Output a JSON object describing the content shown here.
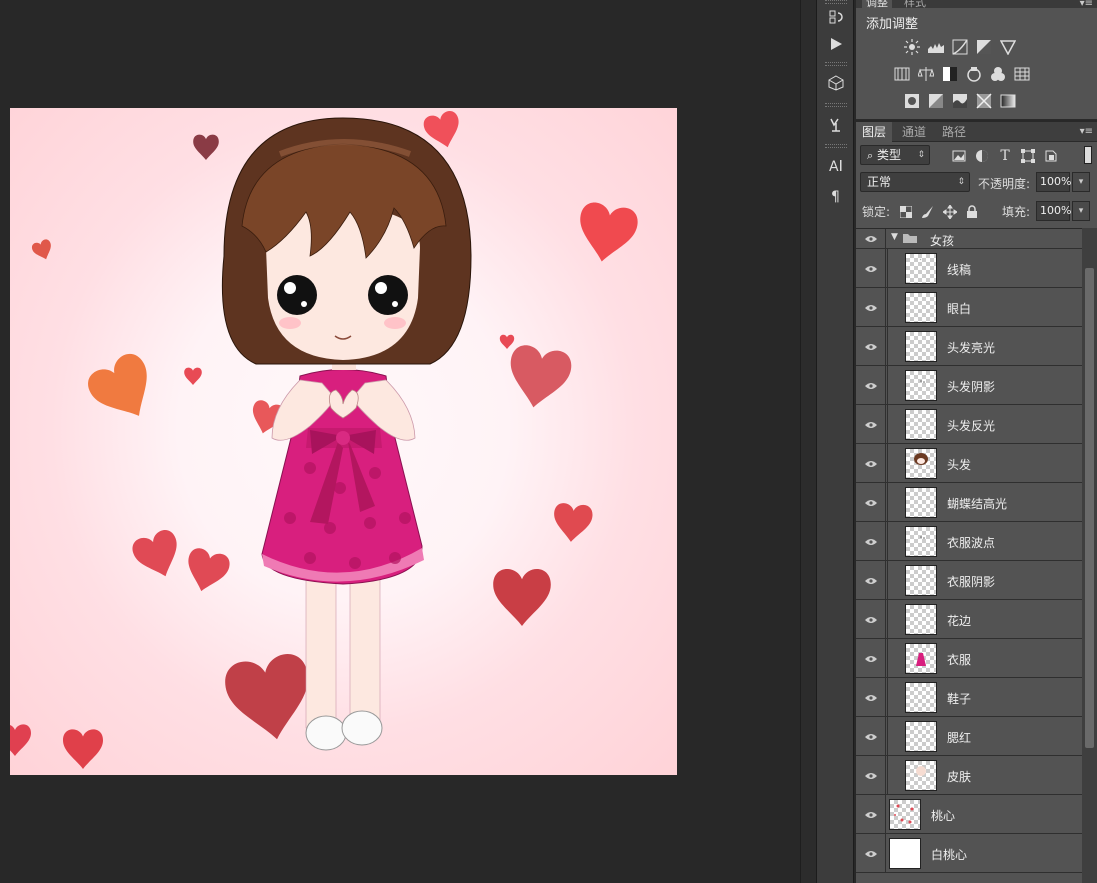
{
  "adjustments": {
    "tabs": [
      "调整",
      "样式"
    ],
    "title": "添加调整",
    "row1": [
      "brightness-contrast-icon",
      "levels-icon",
      "curves-icon",
      "exposure-icon",
      "vibrance-icon"
    ],
    "row2": [
      "hue-saturation-icon",
      "color-balance-icon",
      "black-white-icon",
      "photo-filter-icon",
      "channel-mixer-icon",
      "color-lookup-icon"
    ],
    "row3": [
      "invert-icon",
      "posterize-icon",
      "threshold-icon",
      "selective-color-icon",
      "gradient-map-icon"
    ]
  },
  "layers_panel": {
    "tabs": [
      "图层",
      "通道",
      "路径"
    ],
    "filter_kind": "类型",
    "blend_mode": "正常",
    "opacity_label": "不透明度:",
    "opacity_value": "100%",
    "lock_label": "锁定:",
    "fill_label": "填充:",
    "fill_value": "100%",
    "group_name": "女孩",
    "layers": [
      {
        "name": "线稿",
        "in_group": true,
        "thumb": "lineart"
      },
      {
        "name": "眼白",
        "in_group": true,
        "thumb": "empty"
      },
      {
        "name": "头发亮光",
        "in_group": true,
        "thumb": "empty"
      },
      {
        "name": "头发阴影",
        "in_group": true,
        "thumb": "dots"
      },
      {
        "name": "头发反光",
        "in_group": true,
        "thumb": "empty"
      },
      {
        "name": "头发",
        "in_group": true,
        "thumb": "hair"
      },
      {
        "name": "蝴蝶结高光",
        "in_group": true,
        "thumb": "empty"
      },
      {
        "name": "衣服波点",
        "in_group": true,
        "thumb": "dots"
      },
      {
        "name": "衣服阴影",
        "in_group": true,
        "thumb": "empty"
      },
      {
        "name": "花边",
        "in_group": true,
        "thumb": "empty"
      },
      {
        "name": "衣服",
        "in_group": true,
        "thumb": "dress"
      },
      {
        "name": "鞋子",
        "in_group": true,
        "thumb": "empty"
      },
      {
        "name": "腮红",
        "in_group": true,
        "thumb": "empty"
      },
      {
        "name": "皮肤",
        "in_group": true,
        "thumb": "skin"
      },
      {
        "name": "桃心",
        "in_group": false,
        "thumb": "hearts"
      },
      {
        "name": "白桃心",
        "in_group": false,
        "thumb": "white"
      }
    ]
  },
  "colors": {
    "panel_bg": "#535353",
    "app_bg": "#282828",
    "artboard_pink": "#ffd3d8",
    "dress": "#d81f7e",
    "hair": "#6b3a22"
  }
}
